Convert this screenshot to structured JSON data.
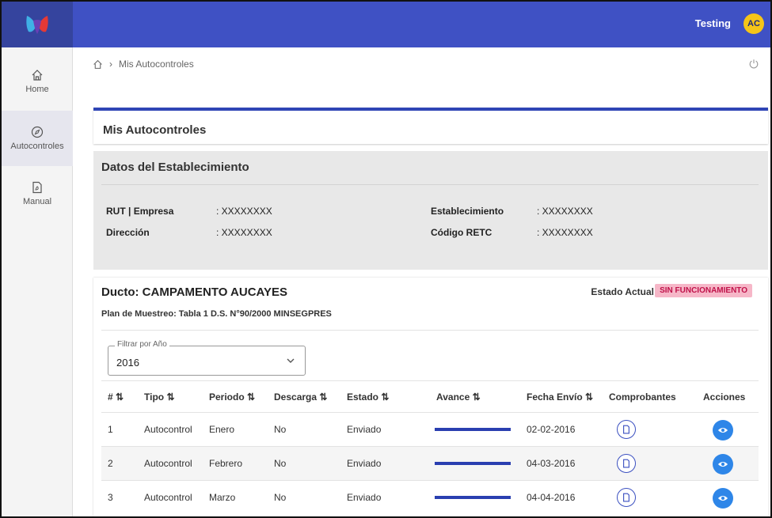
{
  "header": {
    "user_name": "Testing",
    "avatar_initials": "AC"
  },
  "sidebar": {
    "items": [
      {
        "label": "Home",
        "icon": "home-icon"
      },
      {
        "label": "Autocontroles",
        "icon": "compass-icon"
      },
      {
        "label": "Manual",
        "icon": "pdf-document-icon"
      }
    ]
  },
  "breadcrumb": {
    "current": "Mis Autocontroles"
  },
  "page_title": "Mis Autocontroles",
  "datos": {
    "title": "Datos del Establecimiento",
    "rut_label": "RUT | Empresa",
    "rut_value": ": XXXXXXXX",
    "direccion_label": "Dirección",
    "direccion_value": ": XXXXXXXX",
    "establecimiento_label": "Establecimiento",
    "establecimiento_value": ": XXXXXXXX",
    "retc_label": "Código RETC",
    "retc_value": ": XXXXXXXX"
  },
  "ducto": {
    "title": "Ducto: CAMPAMENTO AUCAYES",
    "estado_label": "Estado Actual:",
    "estado_value": "SIN FUNCIONAMIENTO",
    "plan": "Plan de Muestreo: Tabla 1 D.S. N°90/2000 MINSEGPRES",
    "filter_label": "Filtrar por Año",
    "filter_value": "2016"
  },
  "table": {
    "headers": [
      "# ⇅",
      "Tipo ⇅",
      "Periodo ⇅",
      "Descarga ⇅",
      "Estado ⇅",
      "Avance ⇅",
      "Fecha Envío ⇅",
      "Comprobantes",
      "Acciones"
    ],
    "rows": [
      {
        "num": "1",
        "tipo": "Autocontrol",
        "periodo": "Enero",
        "descarga": "No",
        "estado": "Enviado",
        "avance": 100,
        "fecha": "02-02-2016"
      },
      {
        "num": "2",
        "tipo": "Autocontrol",
        "periodo": "Febrero",
        "descarga": "No",
        "estado": "Enviado",
        "avance": 100,
        "fecha": "04-03-2016"
      },
      {
        "num": "3",
        "tipo": "Autocontrol",
        "periodo": "Marzo",
        "descarga": "No",
        "estado": "Enviado",
        "avance": 100,
        "fecha": "04-04-2016"
      }
    ]
  },
  "colors": {
    "primary": "#3f51c4",
    "badge_bg": "#f6b7c8",
    "badge_text": "#c0124a",
    "action_blue": "#2e86e8"
  }
}
